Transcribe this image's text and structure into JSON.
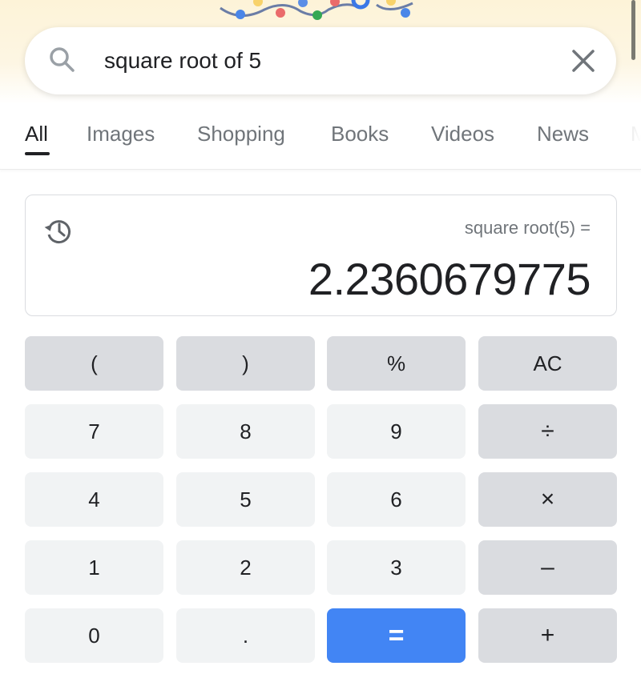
{
  "search": {
    "query": "square root of 5",
    "search_icon": "search-icon",
    "clear_icon": "close-icon"
  },
  "tabs": [
    {
      "label": "All",
      "active": true
    },
    {
      "label": "Images",
      "active": false
    },
    {
      "label": "Shopping",
      "active": false
    },
    {
      "label": "Books",
      "active": false
    },
    {
      "label": "Videos",
      "active": false
    },
    {
      "label": "News",
      "active": false
    },
    {
      "label": "M",
      "active": false
    }
  ],
  "calculator": {
    "history_icon": "history-icon",
    "expression": "square root(5) =",
    "result": "2.2360679775",
    "keys": [
      {
        "label": "(",
        "type": "fn",
        "name": "open-paren"
      },
      {
        "label": ")",
        "type": "fn",
        "name": "close-paren"
      },
      {
        "label": "%",
        "type": "fn",
        "name": "percent"
      },
      {
        "label": "AC",
        "type": "fn",
        "name": "all-clear"
      },
      {
        "label": "7",
        "type": "num",
        "name": "7"
      },
      {
        "label": "8",
        "type": "num",
        "name": "8"
      },
      {
        "label": "9",
        "type": "num",
        "name": "9"
      },
      {
        "label": "÷",
        "type": "fn op",
        "name": "divide"
      },
      {
        "label": "4",
        "type": "num",
        "name": "4"
      },
      {
        "label": "5",
        "type": "num",
        "name": "5"
      },
      {
        "label": "6",
        "type": "num",
        "name": "6"
      },
      {
        "label": "×",
        "type": "fn op",
        "name": "multiply"
      },
      {
        "label": "1",
        "type": "num",
        "name": "1"
      },
      {
        "label": "2",
        "type": "num",
        "name": "2"
      },
      {
        "label": "3",
        "type": "num",
        "name": "3"
      },
      {
        "label": "–",
        "type": "fn op",
        "name": "subtract"
      },
      {
        "label": "0",
        "type": "num",
        "name": "0"
      },
      {
        "label": ".",
        "type": "num",
        "name": "decimal"
      },
      {
        "label": "=",
        "type": "eq",
        "name": "equals"
      },
      {
        "label": "+",
        "type": "fn op",
        "name": "add"
      }
    ]
  },
  "colors": {
    "equals_button": "#4285f4",
    "function_key": "#dadce0",
    "number_key": "#f1f3f4",
    "header_tint": "#fdf3d8"
  }
}
